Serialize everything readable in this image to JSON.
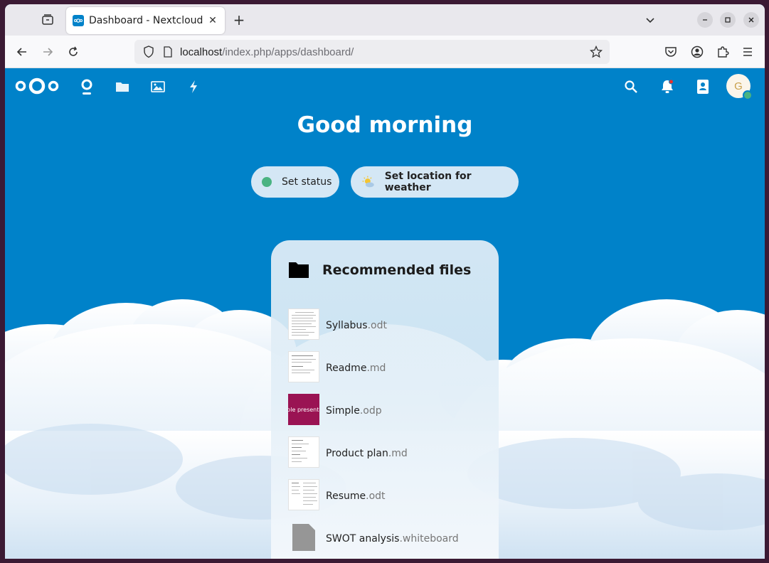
{
  "browser": {
    "tab_title": "Dashboard - Nextcloud",
    "url_host": "localhost",
    "url_path": "/index.php/apps/dashboard/"
  },
  "header": {
    "apps": [
      "dashboard-icon",
      "files-icon",
      "photos-icon",
      "activity-icon"
    ],
    "avatar_initial": "G"
  },
  "greeting": "Good morning",
  "actions": {
    "set_status": "Set status",
    "set_weather": "Set location for weather"
  },
  "panel": {
    "title": "Recommended files",
    "files": [
      {
        "name": "Syllabus",
        "ext": ".odt"
      },
      {
        "name": "Readme",
        "ext": ".md"
      },
      {
        "name": "Simple",
        "ext": ".odp",
        "thumb_text": "mple presentati"
      },
      {
        "name": "Product plan",
        "ext": ".md"
      },
      {
        "name": "Resume",
        "ext": ".odt"
      },
      {
        "name": "SWOT analysis",
        "ext": ".whiteboard"
      }
    ]
  },
  "colors": {
    "brand": "#0082c9",
    "online": "#49b382",
    "presentation": "#9a1353"
  }
}
